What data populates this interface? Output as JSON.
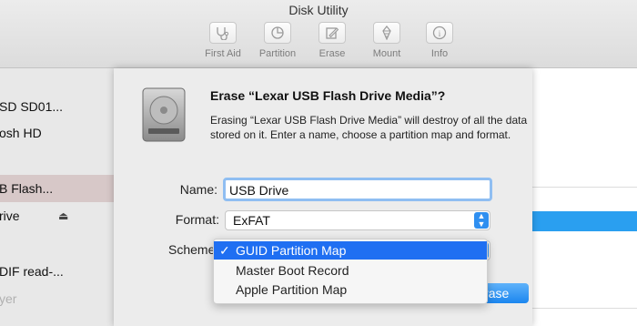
{
  "window": {
    "title": "Disk Utility"
  },
  "toolbar": {
    "buttons": [
      {
        "label": "First Aid",
        "icon": "stethoscope-icon"
      },
      {
        "label": "Partition",
        "icon": "pie-chart-icon"
      },
      {
        "label": "Erase",
        "icon": "eraser-icon"
      },
      {
        "label": "Mount",
        "icon": "mount-icon"
      },
      {
        "label": "Info",
        "icon": "info-icon"
      }
    ]
  },
  "sidebar": {
    "items": [
      {
        "label": "SD SD01..."
      },
      {
        "label": "osh HD"
      },
      {
        "label": "B Flash..."
      },
      {
        "label": "rive"
      },
      {
        "label": "DIF read-..."
      },
      {
        "label": "yer"
      }
    ]
  },
  "dialog": {
    "title": "Erase “Lexar USB Flash Drive Media”?",
    "message": "Erasing “Lexar USB Flash Drive Media” will destroy of all the data stored on it. Enter a name, choose a partition map and format.",
    "name_label": "Name:",
    "name_value": "USB Drive",
    "format_label": "Format:",
    "format_value": "ExFAT",
    "scheme_label": "Scheme",
    "erase_label": "Erase"
  },
  "scheme_menu": {
    "options": [
      {
        "label": "GUID Partition Map",
        "checked": "✓"
      },
      {
        "label": "Master Boot Record"
      },
      {
        "label": "Apple Partition Map"
      }
    ]
  },
  "colors": {
    "accent": "#1f6ff2",
    "selection": "#d7c8c8"
  }
}
